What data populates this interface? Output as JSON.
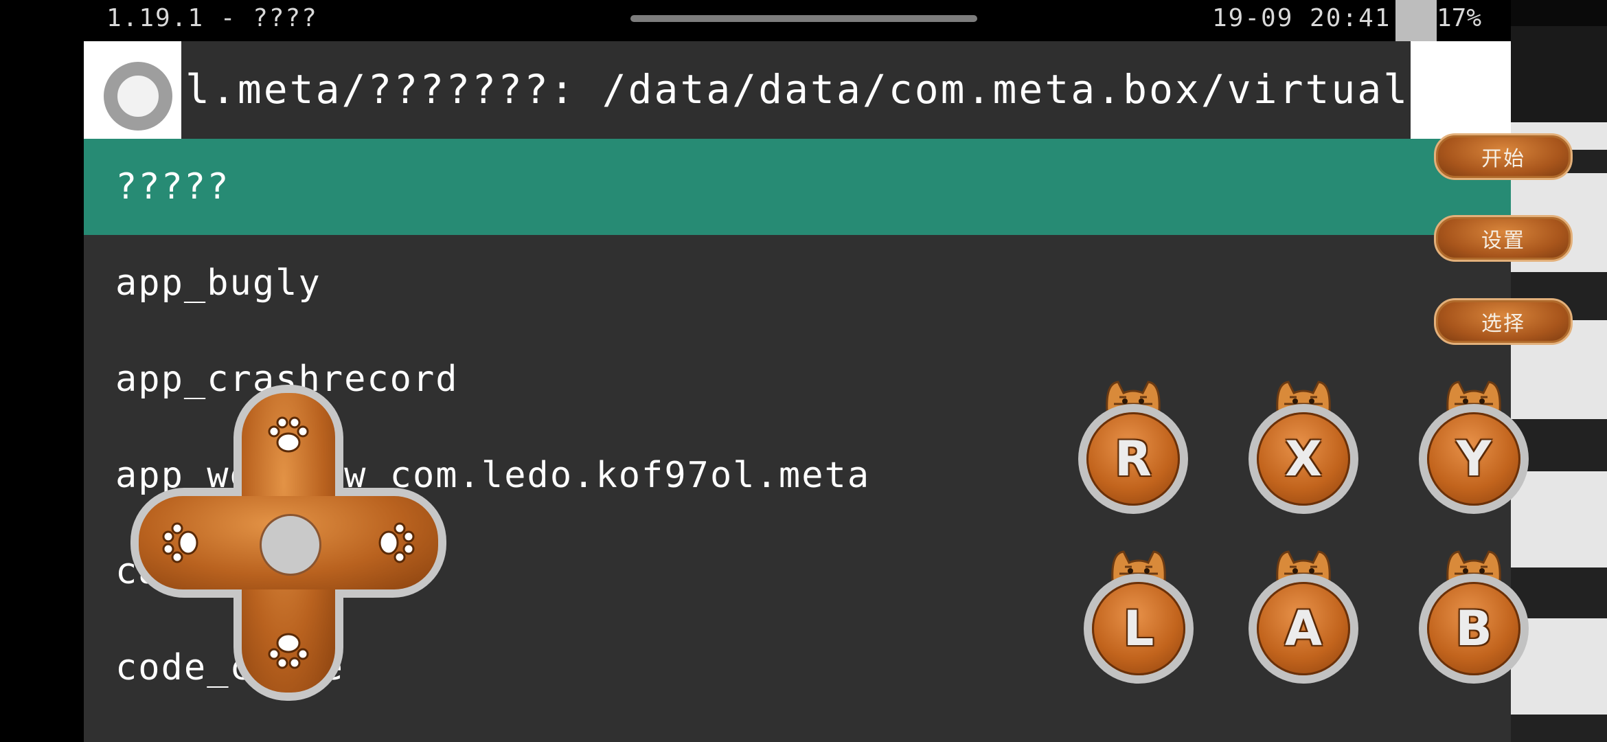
{
  "status_bar": {
    "left_text": "1.19.1 - ????",
    "time": "19-09 20:41",
    "battery": "17%"
  },
  "header": {
    "path": "l.meta/???????: /data/data/com.meta.box/virtual/d",
    "logo_icon": "circle-logo-icon"
  },
  "file_list": {
    "items": [
      {
        "label": "?????",
        "selected": true
      },
      {
        "label": "app_bugly"
      },
      {
        "label": "app_crashrecord"
      },
      {
        "label": "app_webview_com.ledo.kof97ol.meta"
      },
      {
        "label": "cache"
      },
      {
        "label": "code_cache"
      }
    ]
  },
  "menu": {
    "start": "开始",
    "settings": "设置",
    "select": "选择"
  },
  "gamepad": {
    "dpad_icons": [
      "paw-up-icon",
      "paw-left-icon",
      "paw-right-icon",
      "paw-down-icon"
    ],
    "buttons": {
      "r": "R",
      "x": "X",
      "y": "Y",
      "l": "L",
      "a": "A",
      "b": "B"
    }
  },
  "colors": {
    "selected_row": "#278b74",
    "panel_bg": "#303030",
    "button_orange": "#c2641d"
  }
}
